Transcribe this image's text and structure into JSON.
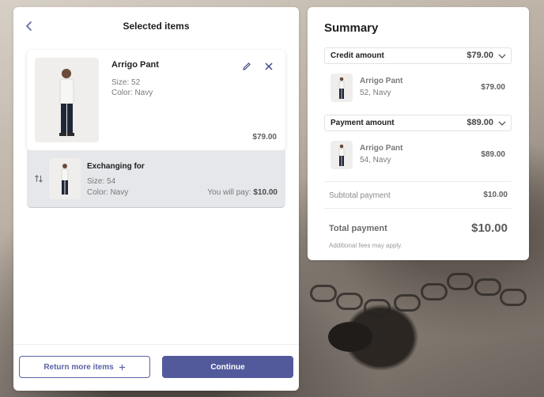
{
  "colors": {
    "accent": "#525a9c",
    "accent_outline": "#5b62a6",
    "exchange_bg": "#e6e7ea"
  },
  "left_panel": {
    "title": "Selected items",
    "back_icon": "chevron-left-icon",
    "original_item": {
      "name": "Arrigo Pant",
      "size": "Size: 52",
      "color": "Color: Navy",
      "price": "$79.00",
      "edit_icon": "pencil-icon",
      "remove_icon": "close-icon"
    },
    "exchange_item": {
      "title": "Exchanging for",
      "size": "Size: 54",
      "color": "Color: Navy",
      "pay_label": "You will pay:",
      "pay_amount": "$10.00",
      "swap_icon": "swap-vertical-icon"
    },
    "footer": {
      "return_more_label": "Return more items",
      "return_more_icon": "plus-icon",
      "continue_label": "Continue"
    }
  },
  "summary": {
    "title": "Summary",
    "credit": {
      "label": "Credit amount",
      "amount": "$79.00",
      "item_name": "Arrigo Pant",
      "item_detail": "52, Navy",
      "item_price": "$79.00"
    },
    "payment": {
      "label": "Payment amount",
      "amount": "$89.00",
      "item_name": "Arrigo Pant",
      "item_detail": "54, Navy",
      "item_price": "$89.00"
    },
    "subtotal_label": "Subtotal payment",
    "subtotal_value": "$10.00",
    "total_label": "Total payment",
    "total_value": "$10.00",
    "fees_note": "Additional fees may apply."
  }
}
